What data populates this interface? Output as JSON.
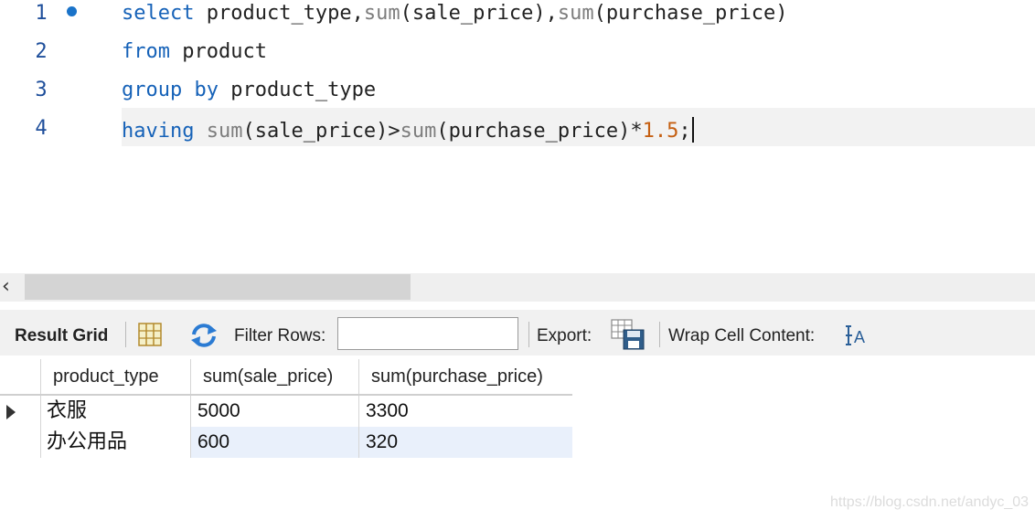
{
  "editor": {
    "lines": [
      {
        "num": "1",
        "tokens": [
          {
            "t": "select",
            "c": "kw"
          },
          {
            "t": " product_type,",
            "c": ""
          },
          {
            "t": "sum",
            "c": "fn"
          },
          {
            "t": "(sale_price),",
            "c": ""
          },
          {
            "t": "sum",
            "c": "fn"
          },
          {
            "t": "(purchase_price)",
            "c": ""
          }
        ]
      },
      {
        "num": "2",
        "tokens": [
          {
            "t": "from",
            "c": "kw"
          },
          {
            "t": " product",
            "c": ""
          }
        ]
      },
      {
        "num": "3",
        "tokens": [
          {
            "t": "group by",
            "c": "kw"
          },
          {
            "t": " product_type",
            "c": ""
          }
        ]
      },
      {
        "num": "4",
        "tokens": [
          {
            "t": "having",
            "c": "kw"
          },
          {
            "t": " ",
            "c": ""
          },
          {
            "t": "sum",
            "c": "fn"
          },
          {
            "t": "(sale_price)>",
            "c": ""
          },
          {
            "t": "sum",
            "c": "fn"
          },
          {
            "t": "(purchase_price)*",
            "c": ""
          },
          {
            "t": "1.5",
            "c": "num"
          },
          {
            "t": ";",
            "c": ""
          }
        ]
      }
    ]
  },
  "toolbar": {
    "result_grid_label": "Result Grid",
    "filter_label": "Filter Rows:",
    "filter_value": "",
    "export_label": "Export:",
    "wrap_label": "Wrap Cell Content:"
  },
  "grid": {
    "columns": [
      "product_type",
      "sum(sale_price)",
      "sum(purchase_price)"
    ],
    "rows": [
      [
        "衣服",
        "5000",
        "3300"
      ],
      [
        "办公用品",
        "600",
        "320"
      ]
    ]
  },
  "watermark": "https://blog.csdn.net/andyc_03",
  "colors": {
    "keyword": "#1662b8",
    "function": "#7d7d7d",
    "number": "#c55f12",
    "selected_row": "#e9f0fb"
  }
}
